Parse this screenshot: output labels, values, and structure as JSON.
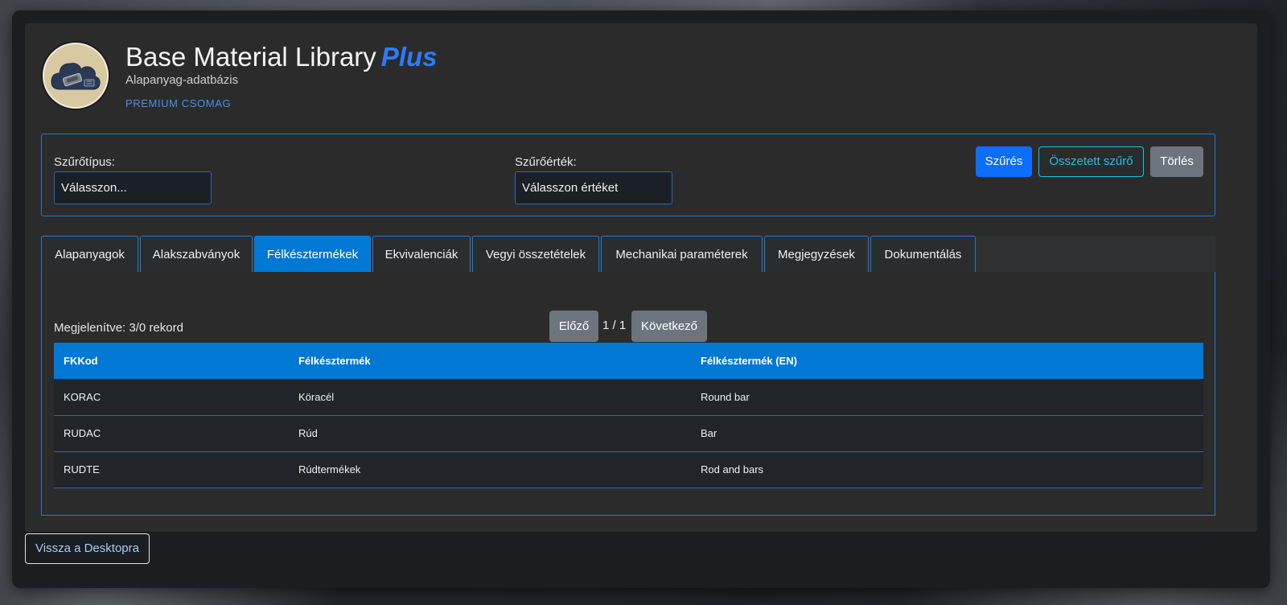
{
  "header": {
    "title": "Base Material Library",
    "title_accent": "Plus",
    "subtitle": "Alapanyag-adatbázis",
    "badge": "PREMIUM CSOMAG"
  },
  "filter": {
    "type_label": "Szűrőtípus:",
    "type_value": "Válasszon...",
    "value_label": "Szűrőérték:",
    "value_value": "Válasszon értéket",
    "filter_button": "Szűrés",
    "compound_button": "Összetett szűrő",
    "clear_button": "Törlés"
  },
  "tabs": [
    {
      "label": "Alapanyagok"
    },
    {
      "label": "Alakszabványok"
    },
    {
      "label": "Félkésztermékek",
      "active": true
    },
    {
      "label": "Ekvivalenciák"
    },
    {
      "label": "Vegyi összetételek"
    },
    {
      "label": "Mechanikai paraméterek"
    },
    {
      "label": "Megjegyzések"
    },
    {
      "label": "Dokumentálás"
    }
  ],
  "content": {
    "record_count": "Megjelenítve: 3/0 rekord",
    "prev_button": "Előző",
    "page_info": "1 / 1",
    "next_button": "Következő",
    "table": {
      "headers": [
        "FKKod",
        "Félkésztermék",
        "Félkésztermék (EN)"
      ],
      "rows": [
        [
          "KORAC",
          "Köracél",
          "Round bar"
        ],
        [
          "RUDAC",
          "Rúd",
          "Bar"
        ],
        [
          "RUDTE",
          "Rúdtermékek",
          "Rod and bars"
        ]
      ]
    }
  },
  "footer": {
    "back_button": "Vissza a Desktopra"
  },
  "colors": {
    "accent": "#0078d4",
    "primary": "#0d6efd",
    "info": "#17c3e8",
    "secondary": "#6c757d"
  },
  "icons": {
    "logo": "cloud-chip-icon"
  }
}
